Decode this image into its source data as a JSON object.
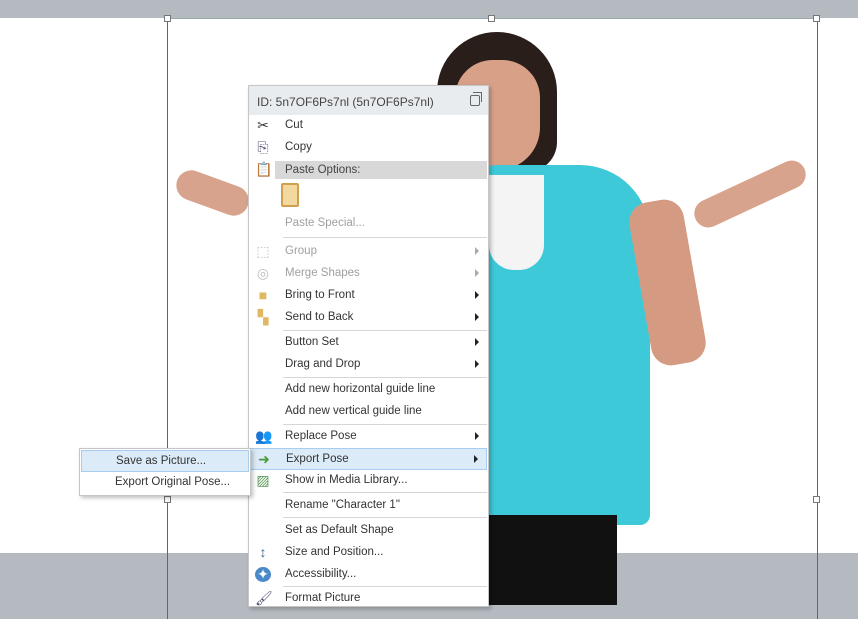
{
  "context_menu": {
    "header_id": "ID: 5n7OF6Ps7nl  (5n7OF6Ps7nl)",
    "cut": "Cut",
    "copy": "Copy",
    "paste_options": "Paste Options:",
    "paste_special": "Paste Special...",
    "group": "Group",
    "merge_shapes": "Merge Shapes",
    "bring_to_front": "Bring to Front",
    "send_to_back": "Send to Back",
    "button_set": "Button Set",
    "drag_and_drop": "Drag and Drop",
    "add_horizontal_guide": "Add new horizontal guide line",
    "add_vertical_guide": "Add new vertical guide line",
    "replace_pose": "Replace Pose",
    "export_pose": "Export Pose",
    "show_in_media_library": "Show in Media Library...",
    "rename": "Rename \"Character 1\"",
    "set_default_shape": "Set as Default Shape",
    "size_and_position": "Size and Position...",
    "accessibility": "Accessibility...",
    "format_picture": "Format Picture"
  },
  "submenu": {
    "save_as_picture": "Save as Picture...",
    "export_original_pose": "Export Original Pose..."
  },
  "colors": {
    "highlight": "#dcebf8",
    "shirt": "#3ec9d9"
  }
}
